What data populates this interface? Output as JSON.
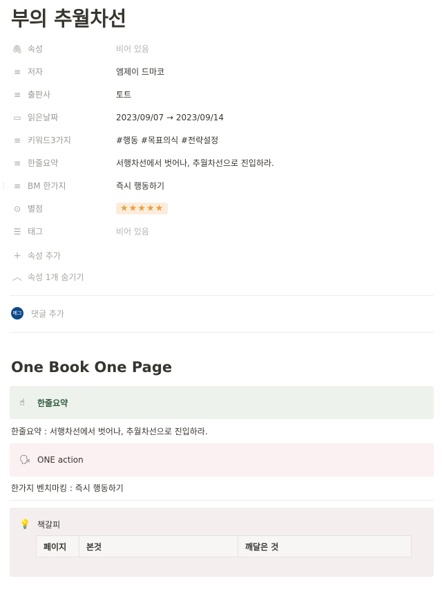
{
  "page": {
    "title": "부의 추월차선",
    "properties": [
      {
        "icon": "paperclip-icon",
        "glyph": "🖇",
        "key": "속성",
        "value": "비어 있음",
        "empty": true
      },
      {
        "icon": "text-lines-icon",
        "glyph": "≡",
        "key": "저자",
        "value": "엠제이 드마코",
        "empty": false
      },
      {
        "icon": "text-lines-icon",
        "glyph": "≡",
        "key": "출판사",
        "value": "토트",
        "empty": false
      },
      {
        "icon": "calendar-icon",
        "glyph": "▭",
        "key": "읽은날짜",
        "value": "2023/09/07 → 2023/09/14",
        "empty": false
      },
      {
        "icon": "text-lines-icon",
        "glyph": "≡",
        "key": "키워드3가지",
        "value": "#행동 #목표의식 #전략설정",
        "empty": false
      },
      {
        "icon": "text-lines-icon",
        "glyph": "≡",
        "key": "한줄요약",
        "value": "서행차선에서 벗어나, 추월차선으로 진입하라.",
        "empty": false
      },
      {
        "icon": "text-lines-icon",
        "glyph": "≡",
        "key": "BM 한가지",
        "value": "즉시 행동하기",
        "empty": false
      },
      {
        "icon": "select-circle-icon",
        "glyph": "⊙",
        "key": "별점",
        "value": "★★★★★",
        "empty": false,
        "stars": true
      },
      {
        "icon": "list-icon",
        "glyph": "☰",
        "key": "태그",
        "value": "비어 있음",
        "empty": true
      }
    ],
    "add_property": "속성 추가",
    "hide_property": "속성 1개 숨기기",
    "avatar_text": "메그",
    "add_comment": "댓글 추가",
    "heading": "One Book One Page",
    "callout_summary": {
      "icon": "☝",
      "label": "한줄요약"
    },
    "summary_text": "한줄요약 : 서행차선에서 벗어나, 추월차선으로 진입하라.",
    "callout_action": {
      "icon": "🗣",
      "label": "ONE action"
    },
    "action_text": "한가지 벤치마킹 : 즉시 행동하기",
    "callout_bookmark": {
      "icon": "💡",
      "label": "책갈피"
    },
    "table_headers": [
      "페이지",
      "본것",
      "깨달은 것"
    ],
    "colors": {
      "green_callout": "#edf3ec",
      "pink_callout": "#fbf0f2",
      "gray_callout": "#f4efee",
      "star": "#e6a33a",
      "avatar": "#0f4a8a"
    }
  }
}
